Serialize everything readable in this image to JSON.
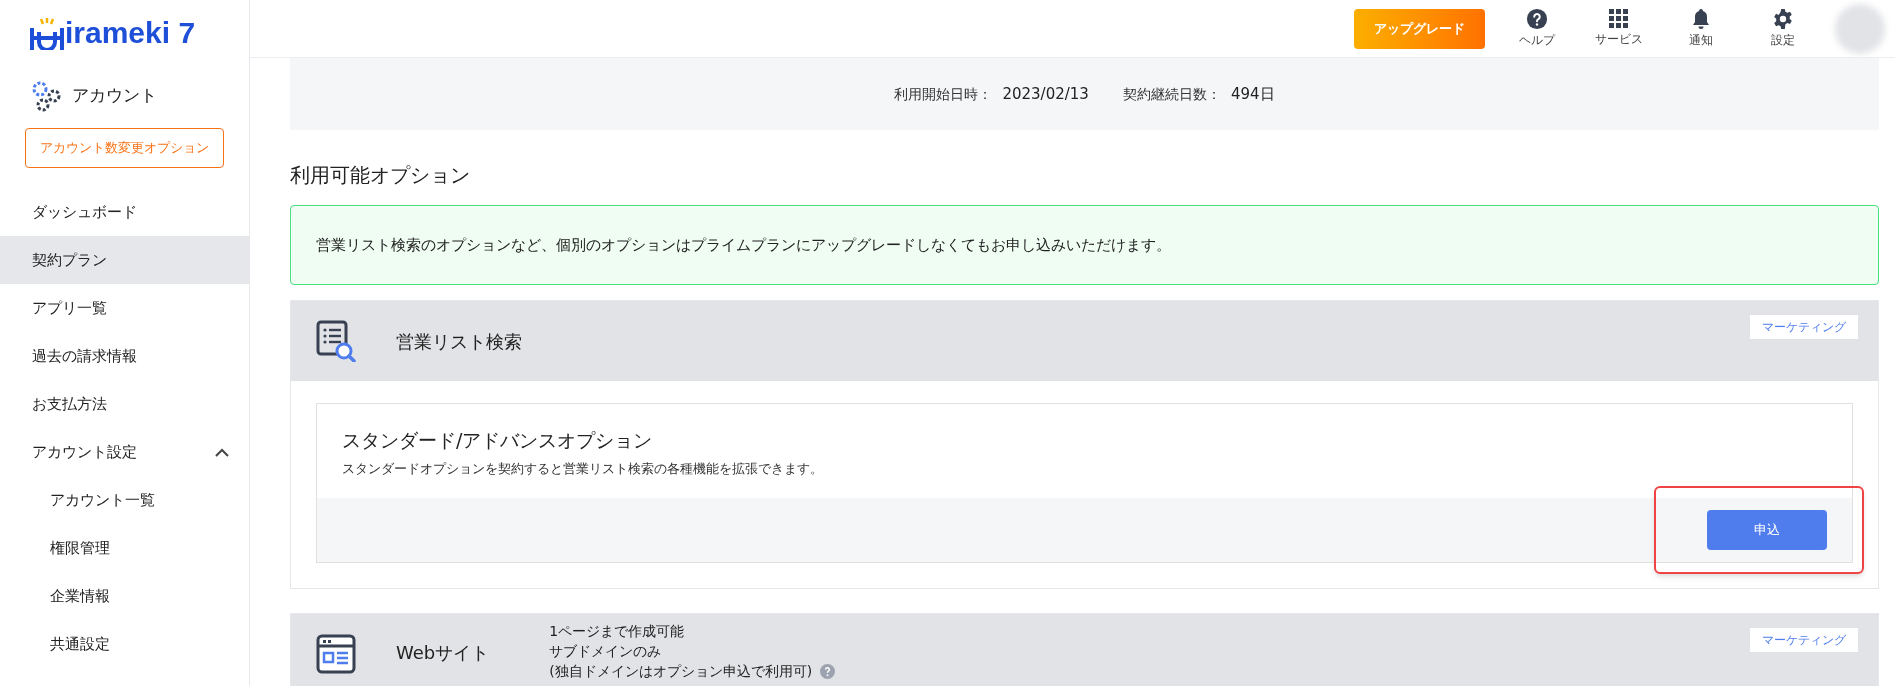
{
  "logo": {
    "text": "irameki 7"
  },
  "sidebar": {
    "heading": "アカウント",
    "option_button": "アカウント数変更オプション",
    "items": [
      {
        "label": "ダッシュボード",
        "selected": false
      },
      {
        "label": "契約プラン",
        "selected": true
      },
      {
        "label": "アプリ一覧",
        "selected": false
      },
      {
        "label": "過去の請求情報",
        "selected": false
      },
      {
        "label": "お支払方法",
        "selected": false
      },
      {
        "label": "アカウント設定",
        "selected": false,
        "expanded": true,
        "children": [
          {
            "label": "アカウント一覧",
            "selected": false
          },
          {
            "label": "権限管理",
            "selected": false
          },
          {
            "label": "企業情報",
            "selected": false
          },
          {
            "label": "共通設定",
            "selected": false
          }
        ]
      }
    ]
  },
  "header": {
    "upgrade": "アップグレード",
    "icons": [
      {
        "kind": "help",
        "label": "ヘルプ"
      },
      {
        "kind": "apps",
        "label": "サービス"
      },
      {
        "kind": "bell",
        "label": "通知"
      },
      {
        "kind": "gear",
        "label": "設定"
      }
    ]
  },
  "contract": [
    {
      "label": "利用開始日時：",
      "value": "2023/02/13"
    },
    {
      "label": "契約継続日数：",
      "value": "494日"
    }
  ],
  "options_title": "利用可能オプション",
  "notice": "営業リスト検索のオプションなど、個別のオプションはプライムプランにアップグレードしなくてもお申し込みいただけます。",
  "sections": [
    {
      "kind": "list-search",
      "title": "営業リスト検索",
      "tag": "マーケティング",
      "options": [
        {
          "title": "スタンダード/アドバンスオプション",
          "description": "スタンダードオプションを契約すると営業リスト検索の各種機能を拡張できます。",
          "button": "申込",
          "highlighted": true
        }
      ]
    },
    {
      "kind": "website",
      "title": "Webサイト",
      "tag": "マーケティング",
      "notes": [
        "1ページまで作成可能",
        "サブドメインのみ",
        "(独自ドメインはオプション申込で利用可)"
      ],
      "help": true
    }
  ]
}
